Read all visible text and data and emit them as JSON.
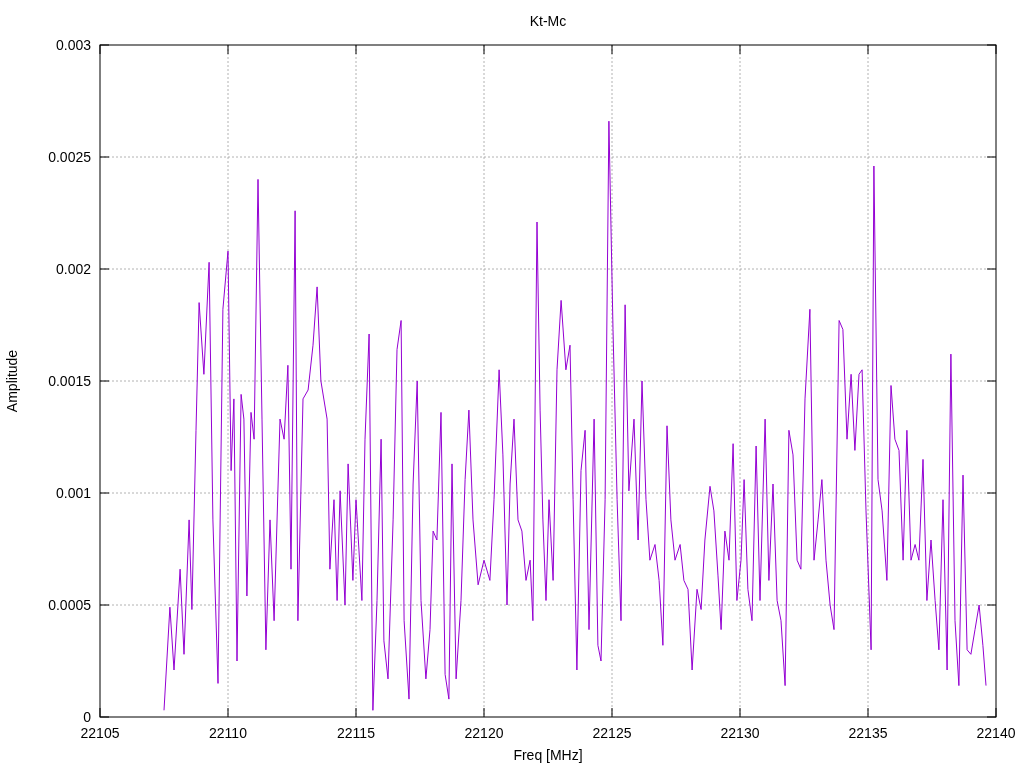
{
  "chart": {
    "chart_data": {
      "type": "line",
      "grid": true,
      "title": "Kt-Mc",
      "xlabel": "Freq [MHz]",
      "ylabel": "Amplitude",
      "x": [
        22107.5,
        22107.73,
        22107.89,
        22108.13,
        22108.28,
        22108.48,
        22108.59,
        22108.75,
        22108.87,
        22109.06,
        22109.26,
        22109.41,
        22109.61,
        22109.8,
        22110.0,
        22110.12,
        22110.23,
        22110.35,
        22110.51,
        22110.62,
        22110.74,
        22110.9,
        22111.02,
        22111.17,
        22111.33,
        22111.48,
        22111.64,
        22111.8,
        22112.03,
        22112.19,
        22112.34,
        22112.46,
        22112.62,
        22112.73,
        22112.93,
        22113.13,
        22113.32,
        22113.48,
        22113.63,
        22113.87,
        22113.98,
        22114.14,
        22114.26,
        22114.38,
        22114.57,
        22114.69,
        22114.88,
        22115.0,
        22115.23,
        22115.35,
        22115.51,
        22115.66,
        22115.82,
        22115.98,
        22116.09,
        22116.25,
        22116.45,
        22116.6,
        22116.76,
        22116.88,
        22117.07,
        22117.23,
        22117.39,
        22117.54,
        22117.73,
        22117.89,
        22118.01,
        22118.16,
        22118.32,
        22118.48,
        22118.63,
        22118.75,
        22118.91,
        22119.1,
        22119.26,
        22119.41,
        22119.57,
        22119.77,
        22120.0,
        22120.23,
        22120.39,
        22120.59,
        22120.74,
        22120.9,
        22121.02,
        22121.17,
        22121.33,
        22121.48,
        22121.64,
        22121.8,
        22121.91,
        22122.07,
        22122.19,
        22122.3,
        22122.42,
        22122.54,
        22122.7,
        22122.85,
        22123.01,
        22123.2,
        22123.36,
        22123.48,
        22123.63,
        22123.79,
        22123.95,
        22124.1,
        22124.3,
        22124.45,
        22124.57,
        22124.73,
        22124.88,
        22125.04,
        22125.2,
        22125.35,
        22125.51,
        22125.66,
        22125.86,
        22126.02,
        22126.17,
        22126.33,
        22126.48,
        22126.68,
        22126.84,
        22126.99,
        22127.15,
        22127.3,
        22127.46,
        22127.66,
        22127.81,
        22127.97,
        22128.13,
        22128.32,
        22128.48,
        22128.63,
        22128.83,
        22128.98,
        22129.14,
        22129.26,
        22129.41,
        22129.57,
        22129.73,
        22129.88,
        22130.04,
        22130.16,
        22130.31,
        22130.47,
        22130.63,
        22130.78,
        22130.98,
        22131.13,
        22131.29,
        22131.45,
        22131.6,
        22131.76,
        22131.91,
        22132.07,
        22132.23,
        22132.38,
        22132.54,
        22132.73,
        22132.89,
        22133.05,
        22133.2,
        22133.36,
        22133.52,
        22133.67,
        22133.87,
        22134.02,
        22134.18,
        22134.34,
        22134.49,
        22134.65,
        22134.77,
        22134.92,
        22135.12,
        22135.23,
        22135.39,
        22135.55,
        22135.74,
        22135.9,
        22136.05,
        22136.21,
        22136.37,
        22136.52,
        22136.68,
        22136.84,
        22136.99,
        22137.15,
        22137.3,
        22137.46,
        22137.62,
        22137.77,
        22137.93,
        22138.09,
        22138.24,
        22138.4,
        22138.55,
        22138.71,
        22138.87,
        22139.02,
        22139.18,
        22139.34,
        22139.49,
        22139.61
      ],
      "series": [
        {
          "color": "#9400d3",
          "values": [
            3e-05,
            0.00049,
            0.00021,
            0.00066,
            0.00028,
            0.00088,
            0.00048,
            0.00128,
            0.00185,
            0.00153,
            0.00203,
            0.00088,
            0.00015,
            0.00182,
            0.00208,
            0.0011,
            0.00142,
            0.00025,
            0.00144,
            0.00133,
            0.00054,
            0.00136,
            0.00124,
            0.0024,
            0.00133,
            0.0003,
            0.00088,
            0.00043,
            0.00133,
            0.00124,
            0.00157,
            0.00066,
            0.00226,
            0.00043,
            0.00142,
            0.00146,
            0.00166,
            0.00192,
            0.0015,
            0.00133,
            0.00066,
            0.00097,
            0.00052,
            0.00101,
            0.0005,
            0.00113,
            0.00061,
            0.00097,
            0.00052,
            0.00124,
            0.00171,
            3e-05,
            0.00052,
            0.00124,
            0.00034,
            0.00017,
            0.00088,
            0.00164,
            0.00177,
            0.00043,
            8e-05,
            0.00104,
            0.0015,
            0.00052,
            0.00017,
            0.00039,
            0.00083,
            0.00079,
            0.00136,
            0.00019,
            8e-05,
            0.00113,
            0.00017,
            0.00052,
            0.00106,
            0.00137,
            0.00088,
            0.00059,
            0.0007,
            0.00061,
            0.00097,
            0.00155,
            0.00117,
            0.0005,
            0.00104,
            0.00133,
            0.00088,
            0.00083,
            0.00061,
            0.0007,
            0.00043,
            0.00221,
            0.00137,
            0.00088,
            0.00052,
            0.00097,
            0.00061,
            0.00155,
            0.00186,
            0.00155,
            0.00166,
            0.00097,
            0.00021,
            0.0011,
            0.00128,
            0.00039,
            0.00133,
            0.00032,
            0.00025,
            0.00097,
            0.00266,
            0.00173,
            0.00097,
            0.00043,
            0.00184,
            0.00101,
            0.00133,
            0.00079,
            0.0015,
            0.00097,
            0.0007,
            0.00077,
            0.00061,
            0.00032,
            0.0013,
            0.00088,
            0.0007,
            0.00077,
            0.00061,
            0.00057,
            0.00021,
            0.00057,
            0.00048,
            0.00079,
            0.00103,
            0.00092,
            0.00063,
            0.00039,
            0.00083,
            0.0007,
            0.00122,
            0.00052,
            0.0007,
            0.00106,
            0.00057,
            0.00043,
            0.00121,
            0.00052,
            0.00133,
            0.00061,
            0.00104,
            0.00052,
            0.00043,
            0.00014,
            0.00128,
            0.00117,
            0.0007,
            0.00066,
            0.00142,
            0.00182,
            0.0007,
            0.00088,
            0.00106,
            0.0007,
            0.0005,
            0.00039,
            0.00177,
            0.00173,
            0.00124,
            0.00153,
            0.00119,
            0.00153,
            0.00155,
            0.00092,
            0.0003,
            0.00246,
            0.00106,
            0.00092,
            0.00061,
            0.00148,
            0.00124,
            0.00119,
            0.0007,
            0.00128,
            0.0007,
            0.00077,
            0.0007,
            0.00115,
            0.00052,
            0.00079,
            0.00052,
            0.0003,
            0.00097,
            0.00021,
            0.00162,
            0.00043,
            0.00014,
            0.00108,
            0.0003,
            0.00028,
            0.00039,
            0.0005,
            0.00032,
            0.00014
          ]
        }
      ],
      "xlim": [
        22105,
        22140
      ],
      "ylim": [
        0,
        0.003
      ],
      "xticks": [
        22105,
        22110,
        22115,
        22120,
        22125,
        22130,
        22135,
        22140
      ],
      "yticks": [
        0,
        0.0005,
        0.001,
        0.0015,
        0.002,
        0.0025,
        0.003
      ]
    }
  }
}
